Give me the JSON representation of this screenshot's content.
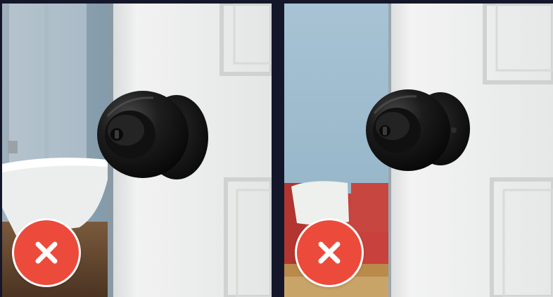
{
  "panels": [
    {
      "scene": "bathroom",
      "status_icon": "close-icon",
      "status_color": "#ec4a3b"
    },
    {
      "scene": "living-room",
      "status_icon": "close-icon",
      "status_color": "#ec4a3b"
    }
  ],
  "colors": {
    "background": "#14172a",
    "door": "#eeeeec",
    "knob": "#151515",
    "accent_red": "#ec4a3b"
  }
}
